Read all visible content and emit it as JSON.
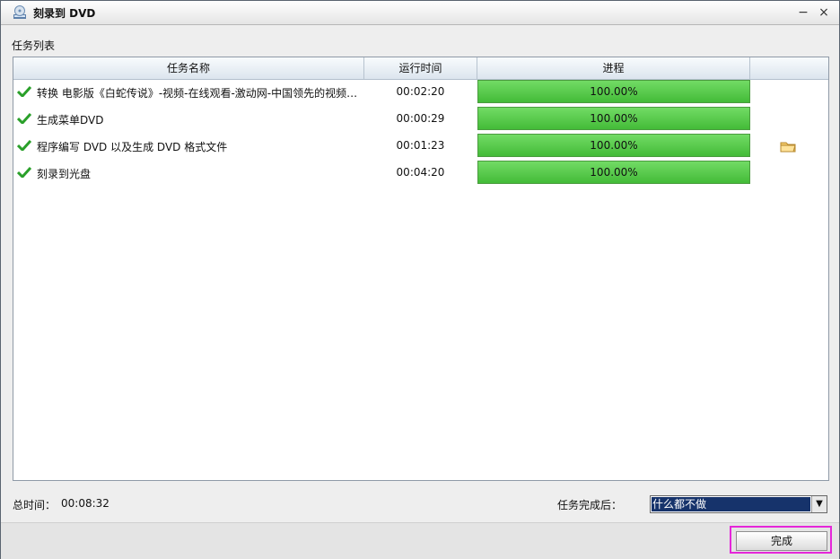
{
  "window": {
    "title": "刻录到 DVD",
    "controls": {
      "minimize": "−",
      "close": "×"
    }
  },
  "task_list": {
    "label": "任务列表",
    "columns": [
      "任务名称",
      "运行时间",
      "进程",
      ""
    ],
    "rows": [
      {
        "status": "check-icon",
        "name": "转换 电影版《白蛇传说》-视频-在线观看-激动网-中国领先的视频…",
        "time": "00:02:20",
        "progress_text": "100.00%",
        "progress": 1.0,
        "action_icon": ""
      },
      {
        "status": "check-icon",
        "name": "生成菜单DVD",
        "time": "00:00:29",
        "progress_text": "100.00%",
        "progress": 1.0,
        "action_icon": ""
      },
      {
        "status": "check-icon",
        "name": "程序编写 DVD 以及生成 DVD 格式文件",
        "time": "00:01:23",
        "progress_text": "100.00%",
        "progress": 1.0,
        "action_icon": "folder-icon"
      },
      {
        "status": "check-icon",
        "name": "刻录到光盘",
        "time": "00:04:20",
        "progress_text": "100.00%",
        "progress": 1.0,
        "action_icon": ""
      }
    ]
  },
  "footer": {
    "total_label": "总时间：",
    "total_value": "00:08:32",
    "after_label": "任务完成后：",
    "after_value": "什么都不做"
  },
  "buttons": {
    "done": "完成"
  },
  "colors": {
    "progress_green": "#4ec143",
    "focus_magenta": "#e526d9",
    "selection_blue": "#16336b"
  }
}
